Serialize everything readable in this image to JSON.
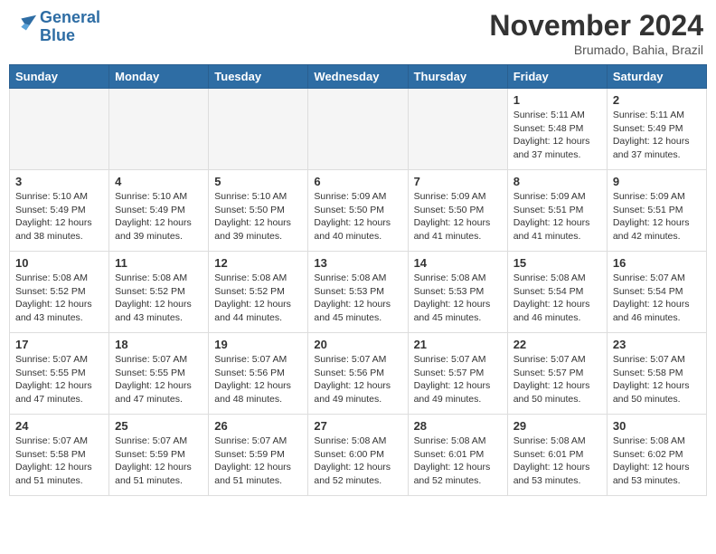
{
  "header": {
    "logo_line1": "General",
    "logo_line2": "Blue",
    "month": "November 2024",
    "location": "Brumado, Bahia, Brazil"
  },
  "weekdays": [
    "Sunday",
    "Monday",
    "Tuesday",
    "Wednesday",
    "Thursday",
    "Friday",
    "Saturday"
  ],
  "weeks": [
    [
      {
        "day": "",
        "info": ""
      },
      {
        "day": "",
        "info": ""
      },
      {
        "day": "",
        "info": ""
      },
      {
        "day": "",
        "info": ""
      },
      {
        "day": "",
        "info": ""
      },
      {
        "day": "1",
        "info": "Sunrise: 5:11 AM\nSunset: 5:48 PM\nDaylight: 12 hours\nand 37 minutes."
      },
      {
        "day": "2",
        "info": "Sunrise: 5:11 AM\nSunset: 5:49 PM\nDaylight: 12 hours\nand 37 minutes."
      }
    ],
    [
      {
        "day": "3",
        "info": "Sunrise: 5:10 AM\nSunset: 5:49 PM\nDaylight: 12 hours\nand 38 minutes."
      },
      {
        "day": "4",
        "info": "Sunrise: 5:10 AM\nSunset: 5:49 PM\nDaylight: 12 hours\nand 39 minutes."
      },
      {
        "day": "5",
        "info": "Sunrise: 5:10 AM\nSunset: 5:50 PM\nDaylight: 12 hours\nand 39 minutes."
      },
      {
        "day": "6",
        "info": "Sunrise: 5:09 AM\nSunset: 5:50 PM\nDaylight: 12 hours\nand 40 minutes."
      },
      {
        "day": "7",
        "info": "Sunrise: 5:09 AM\nSunset: 5:50 PM\nDaylight: 12 hours\nand 41 minutes."
      },
      {
        "day": "8",
        "info": "Sunrise: 5:09 AM\nSunset: 5:51 PM\nDaylight: 12 hours\nand 41 minutes."
      },
      {
        "day": "9",
        "info": "Sunrise: 5:09 AM\nSunset: 5:51 PM\nDaylight: 12 hours\nand 42 minutes."
      }
    ],
    [
      {
        "day": "10",
        "info": "Sunrise: 5:08 AM\nSunset: 5:52 PM\nDaylight: 12 hours\nand 43 minutes."
      },
      {
        "day": "11",
        "info": "Sunrise: 5:08 AM\nSunset: 5:52 PM\nDaylight: 12 hours\nand 43 minutes."
      },
      {
        "day": "12",
        "info": "Sunrise: 5:08 AM\nSunset: 5:52 PM\nDaylight: 12 hours\nand 44 minutes."
      },
      {
        "day": "13",
        "info": "Sunrise: 5:08 AM\nSunset: 5:53 PM\nDaylight: 12 hours\nand 45 minutes."
      },
      {
        "day": "14",
        "info": "Sunrise: 5:08 AM\nSunset: 5:53 PM\nDaylight: 12 hours\nand 45 minutes."
      },
      {
        "day": "15",
        "info": "Sunrise: 5:08 AM\nSunset: 5:54 PM\nDaylight: 12 hours\nand 46 minutes."
      },
      {
        "day": "16",
        "info": "Sunrise: 5:07 AM\nSunset: 5:54 PM\nDaylight: 12 hours\nand 46 minutes."
      }
    ],
    [
      {
        "day": "17",
        "info": "Sunrise: 5:07 AM\nSunset: 5:55 PM\nDaylight: 12 hours\nand 47 minutes."
      },
      {
        "day": "18",
        "info": "Sunrise: 5:07 AM\nSunset: 5:55 PM\nDaylight: 12 hours\nand 47 minutes."
      },
      {
        "day": "19",
        "info": "Sunrise: 5:07 AM\nSunset: 5:56 PM\nDaylight: 12 hours\nand 48 minutes."
      },
      {
        "day": "20",
        "info": "Sunrise: 5:07 AM\nSunset: 5:56 PM\nDaylight: 12 hours\nand 49 minutes."
      },
      {
        "day": "21",
        "info": "Sunrise: 5:07 AM\nSunset: 5:57 PM\nDaylight: 12 hours\nand 49 minutes."
      },
      {
        "day": "22",
        "info": "Sunrise: 5:07 AM\nSunset: 5:57 PM\nDaylight: 12 hours\nand 50 minutes."
      },
      {
        "day": "23",
        "info": "Sunrise: 5:07 AM\nSunset: 5:58 PM\nDaylight: 12 hours\nand 50 minutes."
      }
    ],
    [
      {
        "day": "24",
        "info": "Sunrise: 5:07 AM\nSunset: 5:58 PM\nDaylight: 12 hours\nand 51 minutes."
      },
      {
        "day": "25",
        "info": "Sunrise: 5:07 AM\nSunset: 5:59 PM\nDaylight: 12 hours\nand 51 minutes."
      },
      {
        "day": "26",
        "info": "Sunrise: 5:07 AM\nSunset: 5:59 PM\nDaylight: 12 hours\nand 51 minutes."
      },
      {
        "day": "27",
        "info": "Sunrise: 5:08 AM\nSunset: 6:00 PM\nDaylight: 12 hours\nand 52 minutes."
      },
      {
        "day": "28",
        "info": "Sunrise: 5:08 AM\nSunset: 6:01 PM\nDaylight: 12 hours\nand 52 minutes."
      },
      {
        "day": "29",
        "info": "Sunrise: 5:08 AM\nSunset: 6:01 PM\nDaylight: 12 hours\nand 53 minutes."
      },
      {
        "day": "30",
        "info": "Sunrise: 5:08 AM\nSunset: 6:02 PM\nDaylight: 12 hours\nand 53 minutes."
      }
    ]
  ]
}
